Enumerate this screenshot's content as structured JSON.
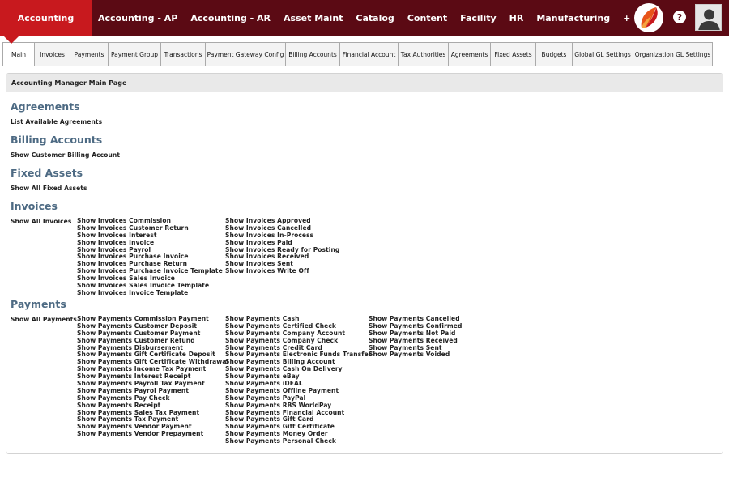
{
  "topbar": {
    "active_app": "Accounting",
    "apps": [
      "Accounting - AP",
      "Accounting - AR",
      "Asset Maint",
      "Catalog",
      "Content",
      "Facility",
      "HR",
      "Manufacturing",
      "+"
    ],
    "help_label": "?"
  },
  "tabs": [
    "Main",
    "Invoices",
    "Payments",
    "Payment Group",
    "Transactions",
    "Payment Gateway Config",
    "Billing Accounts",
    "Financial Account",
    "Tax Authorities",
    "Agreements",
    "Fixed Assets",
    "Budgets",
    "Global GL Settings",
    "Organization GL Settings"
  ],
  "panel": {
    "title": "Accounting Manager Main Page"
  },
  "sections": {
    "agreements": {
      "title": "Agreements",
      "links": [
        "List Available Agreements"
      ]
    },
    "billing": {
      "title": "Billing Accounts",
      "links": [
        "Show Customer Billing Account"
      ]
    },
    "fixed_assets": {
      "title": "Fixed Assets",
      "links": [
        "Show All Fixed Assets"
      ]
    },
    "invoices": {
      "title": "Invoices",
      "all": "Show All Invoices",
      "col1": [
        "Show Invoices Commission",
        "Show Invoices Customer Return",
        "Show Invoices Interest",
        "Show Invoices Invoice",
        "Show Invoices Payrol",
        "Show Invoices Purchase Invoice",
        "Show Invoices Purchase Return",
        "Show Invoices Purchase Invoice Template",
        "Show Invoices Sales Invoice",
        "Show Invoices Sales Invoice Template",
        "Show Invoices Invoice Template"
      ],
      "col2": [
        "Show Invoices Approved",
        "Show Invoices Cancelled",
        "Show Invoices In-Process",
        "Show Invoices Paid",
        "Show Invoices Ready for Posting",
        "Show Invoices Received",
        "Show Invoices Sent",
        "Show Invoices Write Off"
      ]
    },
    "payments": {
      "title": "Payments",
      "all": "Show All Payments",
      "col1": [
        "Show Payments Commission Payment",
        "Show Payments Customer Deposit",
        "Show Payments Customer Payment",
        "Show Payments Customer Refund",
        "Show Payments Disbursement",
        "Show Payments Gift Certificate Deposit",
        "Show Payments Gift Certificate Withdrawal",
        "Show Payments Income Tax Payment",
        "Show Payments Interest Receipt",
        "Show Payments Payroll Tax Payment",
        "Show Payments Payrol Payment",
        "Show Payments Pay Check",
        "Show Payments Receipt",
        "Show Payments Sales Tax Payment",
        "Show Payments Tax Payment",
        "Show Payments Vendor Payment",
        "Show Payments Vendor Prepayment"
      ],
      "col2": [
        "Show Payments Cash",
        "Show Payments Certified Check",
        "Show Payments Company Account",
        "Show Payments Company Check",
        "Show Payments Credit Card",
        "Show Payments Electronic Funds Transfer",
        "Show Payments Billing Account",
        "Show Payments Cash On Delivery",
        "Show Payments eBay",
        "Show Payments iDEAL",
        "Show Payments Offline Payment",
        "Show Payments PayPal",
        "Show Payments RBS WorldPay",
        "Show Payments Financial Account",
        "Show Payments Gift Card",
        "Show Payments Gift Certificate",
        "Show Payments Money Order",
        "Show Payments Personal Check"
      ],
      "col3": [
        "Show Payments Cancelled",
        "Show Payments Confirmed",
        "Show Payments Not Paid",
        "Show Payments Received",
        "Show Payments Sent",
        "Show Payments Voided"
      ]
    }
  },
  "colors": {
    "topbar": "#5b0a14",
    "active_app": "#c8191e",
    "section_title": "#4d6a83"
  }
}
